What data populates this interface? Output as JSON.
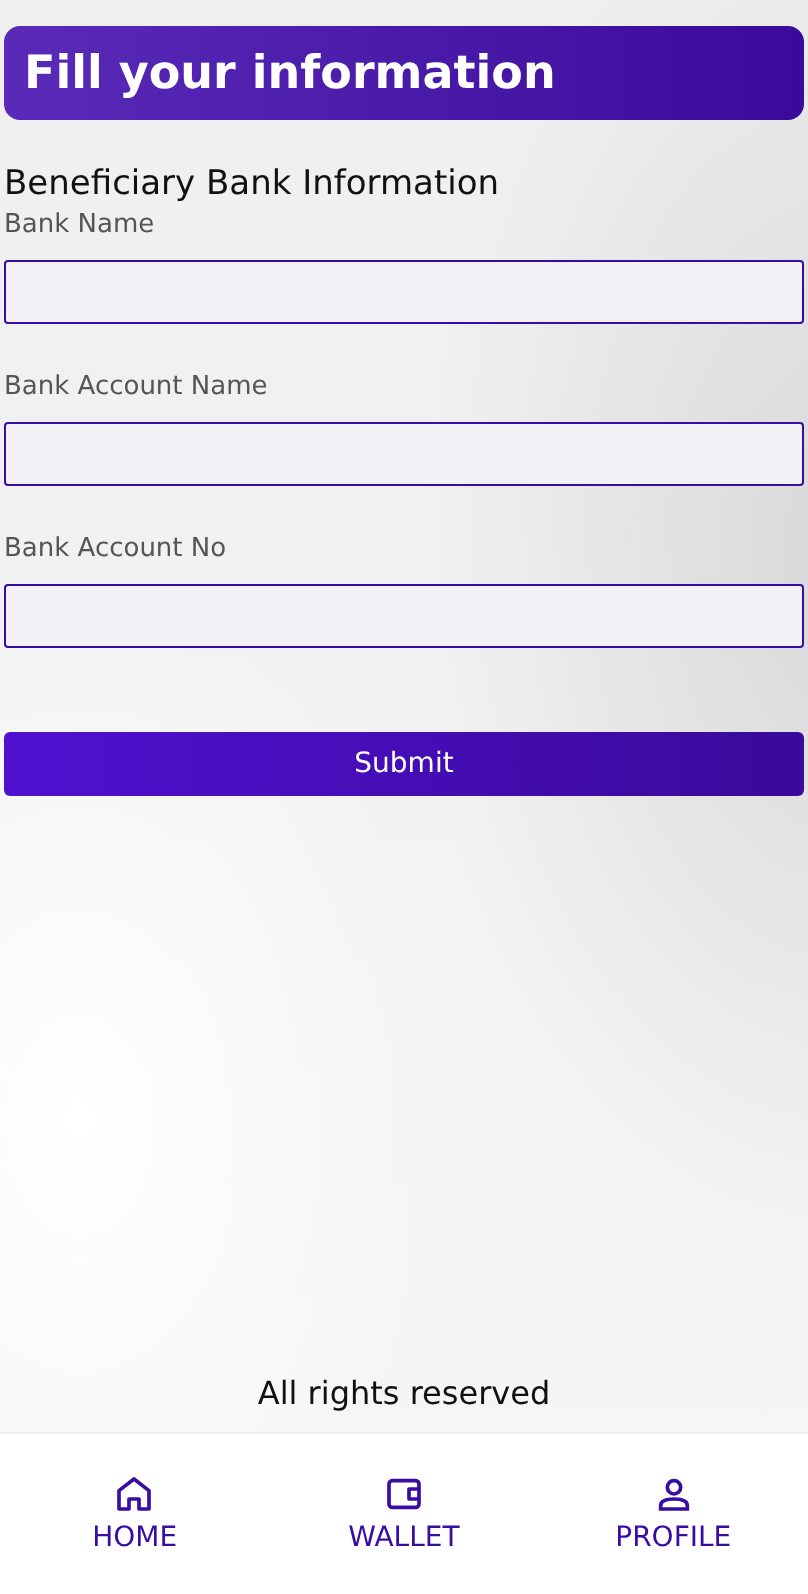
{
  "header": {
    "title": "Fill your information"
  },
  "section_title": "Beneficiary Bank Information",
  "fields": [
    {
      "label": "Bank Name"
    },
    {
      "label": "Bank Account Name"
    },
    {
      "label": "Bank Account No"
    }
  ],
  "submit": "Submit",
  "footer": "All rights reserved",
  "nav": [
    {
      "kind": "home",
      "label": "HOME"
    },
    {
      "kind": "wallet",
      "label": "WALLET"
    },
    {
      "kind": "profile",
      "label": "PROFILE"
    }
  ]
}
